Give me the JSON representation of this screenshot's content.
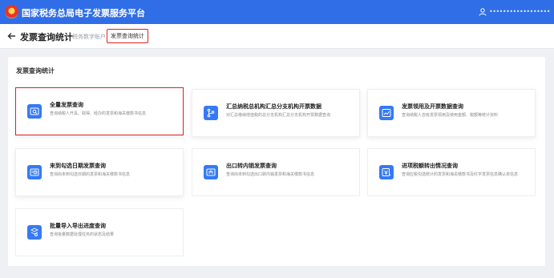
{
  "header": {
    "app_title": "国家税务总局电子发票服务平台",
    "user_name": "••••••••••••••••••"
  },
  "subheader": {
    "page_title": "发票查询统计",
    "breadcrumbs": [
      "税务数字账户",
      "发票查询统计"
    ]
  },
  "panel": {
    "title": "发票查询统计",
    "cards": [
      {
        "title": "全量发票查询",
        "desc": "查询纳税人开具、取得、经办的发票和海关缴款书信息",
        "icon": "invoice-search-icon"
      },
      {
        "title": "汇总纳税总机构汇总分支机构开票数据",
        "desc": "对汇总缴纳增值税的总分支机构汇总分支机构开票数据查询",
        "icon": "branch-tree-icon"
      },
      {
        "title": "发票领用及开票数据查询",
        "desc": "查询纳税人自有发票领用及使用金额、税额等统计资料",
        "icon": "trend-chart-icon"
      },
      {
        "title": "来到勾选日期发票查询",
        "desc": "查询尚未到勾选日期的发票和海关缴款书信息",
        "icon": "calendar-invoice-icon"
      },
      {
        "title": "出口转内销发票查询",
        "desc": "查询尚未到勾选出口转内销发票和海关缴款书信息",
        "icon": "export-domestic-icon"
      },
      {
        "title": "进项税额转出情况查询",
        "desc": "查询应税勾选统计的发票和海关缴款书及红字发票信息确认单信息",
        "icon": "tax-transfer-icon"
      },
      {
        "title": "批量导入导出进度查询",
        "desc": "查询批量数据处理任务的状态及结果",
        "icon": "batch-progress-icon"
      }
    ]
  },
  "colors": {
    "brand": "#2f6ee6",
    "accent": "#3579f6",
    "highlight": "#e02020"
  }
}
